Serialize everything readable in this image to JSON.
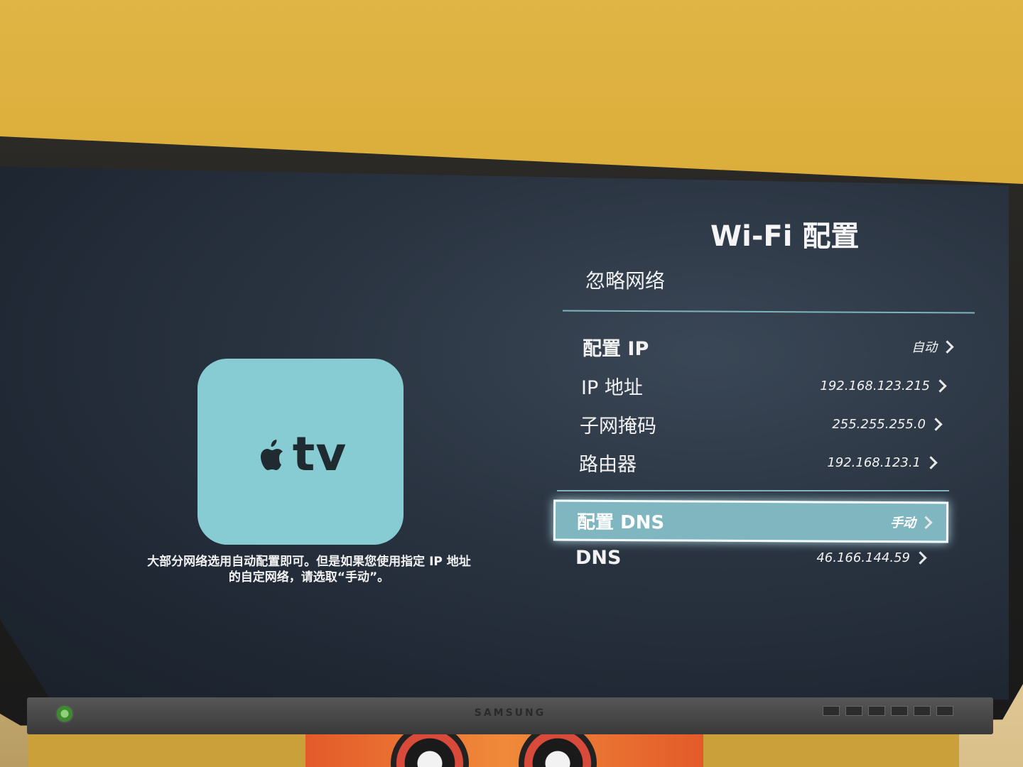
{
  "screen": {
    "title": "Wi-Fi 配置",
    "ignore_network": "忽略网络",
    "app_tile": {
      "mark": "tv"
    },
    "helper_text": "大部分网络选用自动配置即可。但是如果您使用指定 IP 地址的自定网络，请选取“手动”。",
    "rows": [
      {
        "label": "配置 IP",
        "value": "自动"
      },
      {
        "label": "IP 地址",
        "value": "192.168.123.215"
      },
      {
        "label": "子网掩码",
        "value": "255.255.255.0"
      },
      {
        "label": "路由器",
        "value": "192.168.123.1"
      },
      {
        "label": "配置 DNS",
        "value": "手动"
      },
      {
        "label": "DNS",
        "value": "46.166.144.59"
      }
    ],
    "focused_row": "配置 DNS",
    "colors": {
      "focus_fill": "#7fb6c0",
      "tile": "#86ccd2",
      "screen_bg": "#2a3441"
    }
  },
  "monitor": {
    "brand": "SAMSUNG"
  }
}
